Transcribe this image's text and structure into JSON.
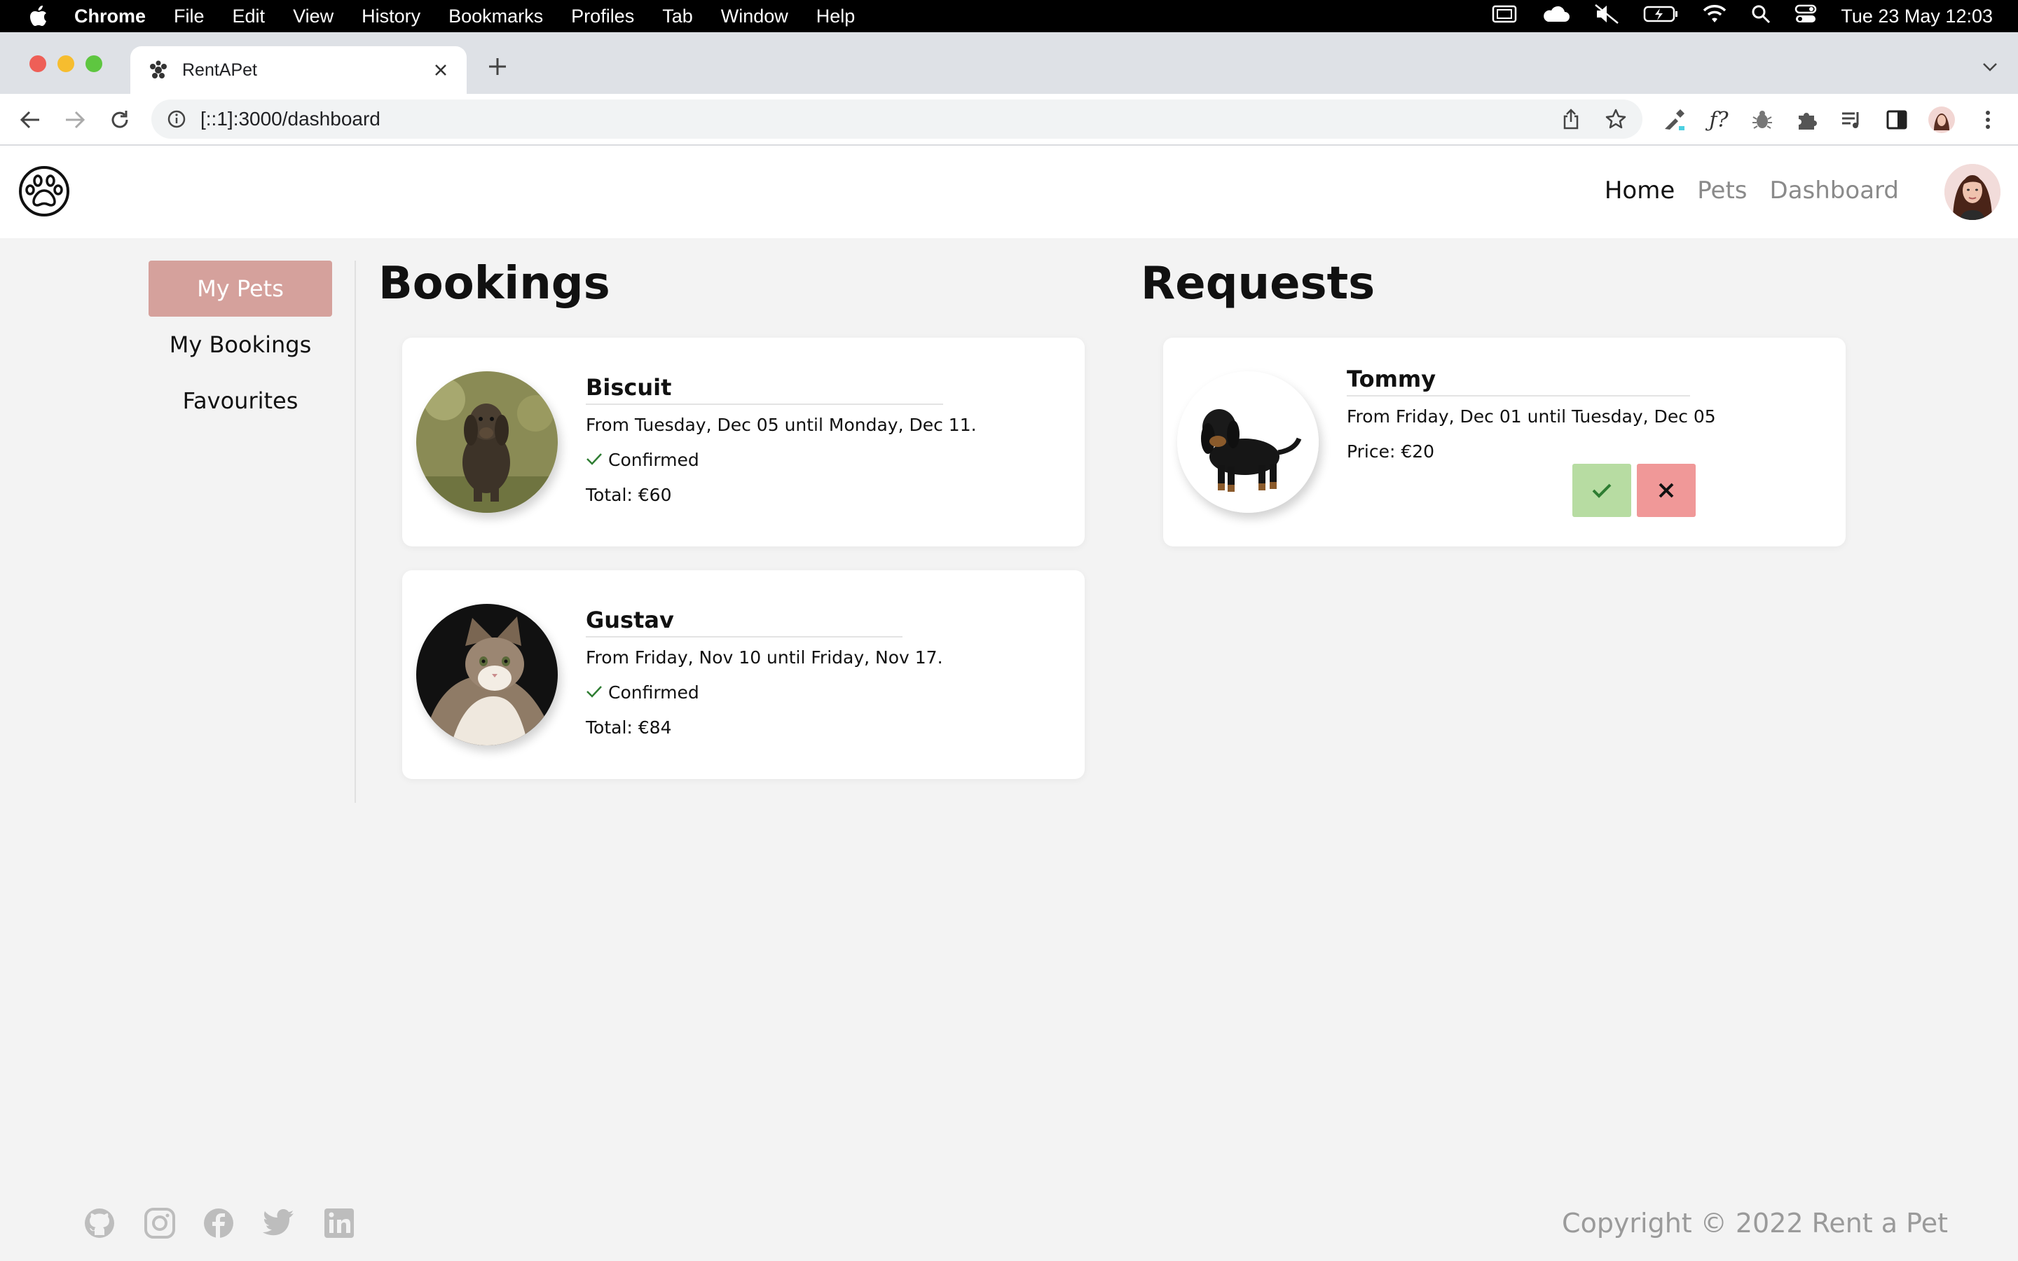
{
  "menubar": {
    "app": "Chrome",
    "items": [
      "File",
      "Edit",
      "View",
      "History",
      "Bookmarks",
      "Profiles",
      "Tab",
      "Window",
      "Help"
    ],
    "clock": "Tue 23 May  12:03"
  },
  "browser": {
    "tab_title": "RentAPet",
    "url": "[::1]:3000/dashboard"
  },
  "site": {
    "nav": [
      "Home",
      "Pets",
      "Dashboard"
    ],
    "active_nav": "Home"
  },
  "sidebar": {
    "items": [
      "My Pets",
      "My Bookings",
      "Favourites"
    ]
  },
  "bookings": {
    "title": "Bookings",
    "items": [
      {
        "name": "Biscuit",
        "dates": "From Tuesday, Dec 05 until Monday, Dec 11.",
        "status": "Confirmed",
        "total": "Total: €60",
        "photo": "dachshund-photo"
      },
      {
        "name": "Gustav",
        "dates": "From Friday, Nov 10 until Friday, Nov 17.",
        "status": "Confirmed",
        "total": "Total: €84",
        "photo": "cat-photo"
      }
    ]
  },
  "requests": {
    "title": "Requests",
    "items": [
      {
        "name": "Tommy",
        "dates": "From Friday, Dec 01 until Tuesday, Dec 05",
        "price": "Price: €20",
        "photo": "black-dachshund-photo"
      }
    ]
  },
  "footer": {
    "icons": [
      "github-icon",
      "instagram-icon",
      "facebook-icon",
      "twitter-icon",
      "linkedin-icon"
    ],
    "copyright": "Copyright © 2022 Rent a Pet"
  },
  "colors": {
    "accent": "#d5a19c",
    "accept": "#b7dca2",
    "decline": "#f09898",
    "confirmed_check": "#2e7d32"
  }
}
